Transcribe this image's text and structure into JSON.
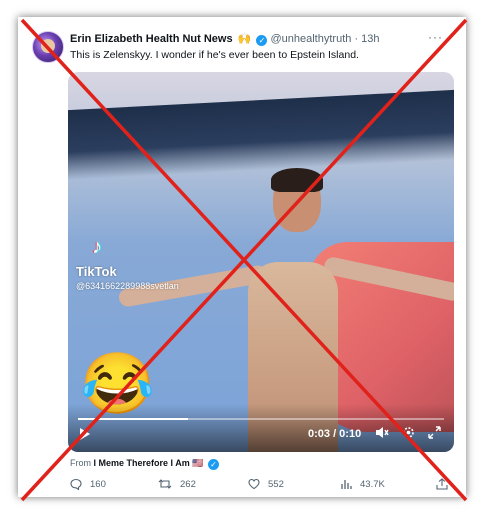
{
  "tweet": {
    "author_name": "Erin Elizabeth Health Nut News",
    "author_emoji": "🙌",
    "handle": "@unhealthytruth",
    "separator": "·",
    "time": "13h",
    "more_label": "···",
    "text": "This is Zelenskyy. I wonder if he's ever been to Epstein Island."
  },
  "video": {
    "watermark_brand": "TikTok",
    "watermark_id": "@6341662289988svetlan",
    "emoji": "😂",
    "current_time": "0:03 / 0:10",
    "progress": 0.3,
    "controls": [
      "play-icon",
      "mute-icon",
      "settings-icon",
      "fullscreen-icon"
    ]
  },
  "attribution": {
    "prefix": "From",
    "account": "I Meme Therefore I Am",
    "flag": "🇺🇸"
  },
  "actions": {
    "replies": "160",
    "retweets": "262",
    "likes": "552",
    "views": "43.7K"
  },
  "colors": {
    "accent": "#1d9bf0",
    "overlay_x": "#e0221b"
  }
}
